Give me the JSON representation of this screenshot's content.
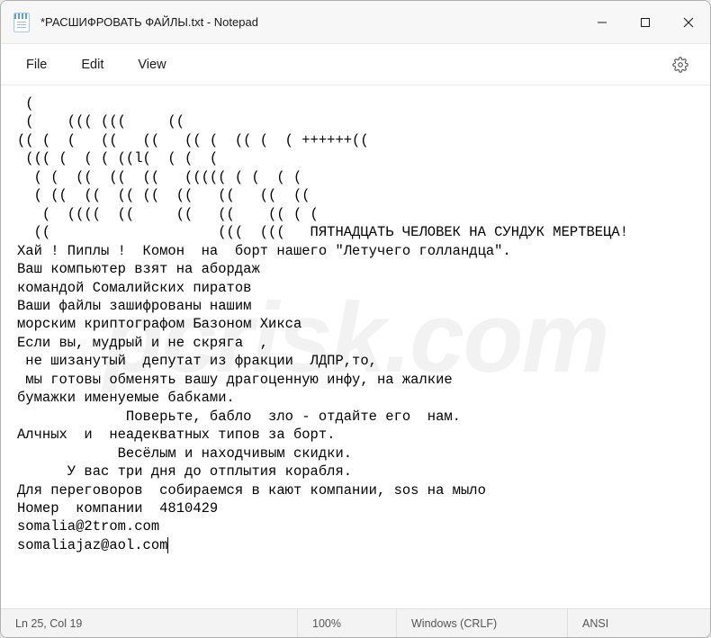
{
  "window": {
    "title": "*РАСШИФРОВАТЬ ФАЙЛЫ.txt - Notepad"
  },
  "menu": {
    "file": "File",
    "edit": "Edit",
    "view": "View"
  },
  "content": {
    "text": " (\n (    ((( (((     ((\n(( (  (   ((   ((   (( (  (( (  ( ++++++((\n ((( (  ( ( ((l(  ( (  (\n  ( (  ((  ((  ((   ((((( ( (  ( (\n  ( ((  ((  (( ((  ((   ((   ((  ((\n   (  ((((  ((     ((   ((    (( ( (\n  ((                    (((  (((   ПЯТНАДЦАТЬ ЧЕЛОВЕК НА СУНДУК МЕРТВЕЦА!\nХай ! Пиплы !  Комон  на  борт нашего \"Летучего голландца\".\nВаш компьютер взят на абордаж\nкомандой Сомалийских пиратов\nВаши файлы зашифрованы нашим\nморским криптографом Базоном Хикса\nЕсли вы, мудрый и не скряга  ,\n не шизанутый  депутат из фракции  ЛДПР,то,\n мы готовы обменять вашу драгоценную инфу, на жалкие\nбумажки именуемые бабками.\n             Поверьте, бабло  зло - отдайте его  нам.\nАлчных  и  неадекватных типов за борт.\n            Весёлым и находчивым скидки.\n      У вас три дня до отплытия корабля.\nДля переговоров  собираемся в кают компании, sos на мыло\nНомер  компании  4810429\nsomalia@2trom.com\nsomaliajaz@aol.com"
  },
  "status": {
    "position": "Ln 25, Col 19",
    "zoom": "100%",
    "line_ending": "Windows (CRLF)",
    "encoding": "ANSI"
  }
}
